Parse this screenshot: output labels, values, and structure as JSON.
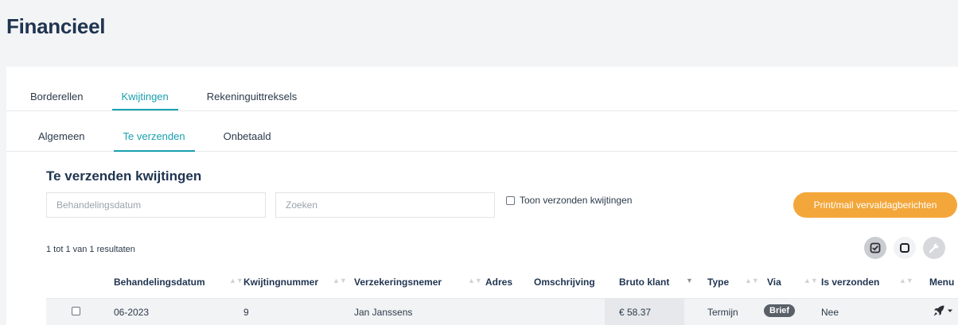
{
  "page": {
    "title": "Financieel"
  },
  "tabs_main": [
    "Borderellen",
    "Kwijtingen",
    "Rekeninguittreksels"
  ],
  "tabs_sub": [
    "Algemeen",
    "Te verzenden",
    "Onbetaald"
  ],
  "section": {
    "title": "Te verzenden kwijtingen"
  },
  "filters": {
    "date_placeholder": "Behandelingsdatum",
    "search_placeholder": "Zoeken",
    "checkbox_label": "Toon verzonden kwijtingen",
    "print_button": "Print/mail vervaldagberichten"
  },
  "results_text": "1 tot 1 van 1 resultaten",
  "table": {
    "columns": [
      "Behandelingsdatum",
      "Kwijtingnummer",
      "Verzekeringsnemer",
      "Adres",
      "Omschrijving",
      "Bruto klant",
      "Type",
      "Via",
      "Is verzonden",
      "Menu"
    ],
    "row": {
      "date": "06-2023",
      "number": "9",
      "insured": "Jan Janssens",
      "address": "",
      "description": "",
      "gross": "€ 58.37",
      "type": "Termijn",
      "via": "Brief",
      "sent": "Nee"
    }
  },
  "colors": {
    "accent": "#1aa0b0",
    "button": "#f3a73b",
    "title": "#1f3450"
  },
  "icons": [
    "check-square-icon",
    "square-icon",
    "wrench-icon",
    "rocket-icon",
    "caret-down-icon"
  ]
}
